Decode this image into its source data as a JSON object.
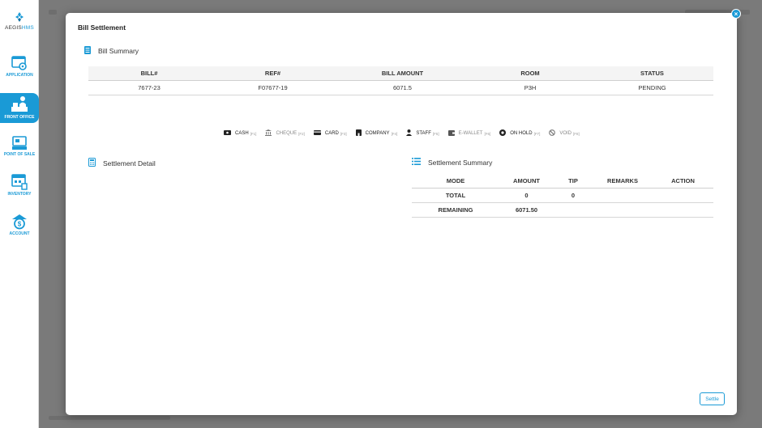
{
  "sidebar": {
    "logo": {
      "prefix": "AEGIS",
      "suffix": "HMS"
    },
    "items": [
      {
        "label": "APPLICATION",
        "icon": "application-settings-icon"
      },
      {
        "label": "FRONT OFFICE",
        "icon": "front-office-icon",
        "active": true
      },
      {
        "label": "POINT OF SALE",
        "icon": "point-of-sale-icon"
      },
      {
        "label": "INVENTORY",
        "icon": "inventory-icon"
      },
      {
        "label": "ACCOUNT",
        "icon": "account-dollar-icon"
      }
    ]
  },
  "modal": {
    "title": "Bill Settlement",
    "close_icon": "close-icon",
    "bill_summary": {
      "title": "Bill Summary",
      "columns": [
        "BILL#",
        "REF#",
        "BILL AMOUNT",
        "ROOM",
        "STATUS"
      ],
      "rows": [
        [
          "7677-23",
          "F07677-19",
          "6071.5",
          "P3H",
          "PENDING"
        ]
      ]
    },
    "payment_modes": [
      {
        "label": "CASH",
        "key": "[F1]",
        "icon": "cash-icon"
      },
      {
        "label": "CHEQUE",
        "key": "[F2]",
        "icon": "bank-icon",
        "disabled": true
      },
      {
        "label": "CARD",
        "key": "[F3]",
        "icon": "card-icon"
      },
      {
        "label": "COMPANY",
        "key": "[F4]",
        "icon": "company-icon"
      },
      {
        "label": "STAFF",
        "key": "[F5]",
        "icon": "staff-icon"
      },
      {
        "label": "E-WALLET",
        "key": "[F6]",
        "icon": "wallet-icon",
        "disabled": true
      },
      {
        "label": "ON HOLD",
        "key": "[F7]",
        "icon": "on-hold-icon"
      },
      {
        "label": "VOID",
        "key": "[F8]",
        "icon": "void-icon",
        "disabled": true
      }
    ],
    "settlement_detail": {
      "title": "Settlement Detail"
    },
    "settlement_summary": {
      "title": "Settlement Summary",
      "columns": [
        "MODE",
        "AMOUNT",
        "TIP",
        "REMARKS",
        "ACTION"
      ],
      "rows": [
        [
          "TOTAL",
          "0",
          "0",
          "",
          ""
        ],
        [
          "REMAINING",
          "6071.50",
          "",
          "",
          ""
        ]
      ]
    },
    "settle_button": "Settle"
  },
  "colors": {
    "accent": "#1a9ad6",
    "overlay": "#7a7a7a"
  }
}
